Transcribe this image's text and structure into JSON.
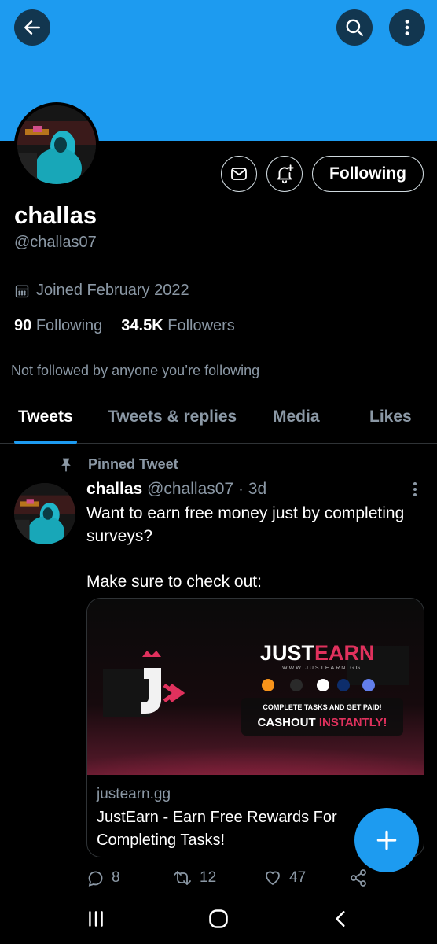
{
  "header": {
    "back_icon": "arrow-left-icon",
    "search_icon": "search-icon",
    "more_icon": "more-vertical-icon",
    "banner_color": "#1d9bf0"
  },
  "profile": {
    "name": "challas",
    "handle": "@challas07",
    "joined": "Joined February 2022",
    "following_count": "90",
    "following_label": "Following",
    "followers_count": "34.5K",
    "followers_label": "Followers",
    "not_followed": "Not followed by anyone you’re following",
    "follow_button": "Following"
  },
  "tabs": [
    {
      "label": "Tweets",
      "active": true
    },
    {
      "label": "Tweets & replies",
      "active": false
    },
    {
      "label": "Media",
      "active": false
    },
    {
      "label": "Likes",
      "active": false
    }
  ],
  "tweet": {
    "pinned_label": "Pinned Tweet",
    "author_name": "challas",
    "author_meta": "@challas07 · 3d",
    "text": "Want to earn free money just by completing surveys?\n\nMake sure to check out:",
    "card": {
      "brand_just": "JUST",
      "brand_earn": "EARN",
      "brand_url": "WWW.JUSTEARN.GG",
      "tagline": "COMPLETE TASKS AND GET PAID!",
      "cashout": "CASHOUT",
      "instantly": "INSTANTLY!",
      "domain": "justearn.gg",
      "title": "JustEarn - Earn Free Rewards For Completing Tasks!"
    },
    "replies": "8",
    "retweets": "12",
    "likes": "47"
  },
  "accent_color": "#1d9bf0"
}
